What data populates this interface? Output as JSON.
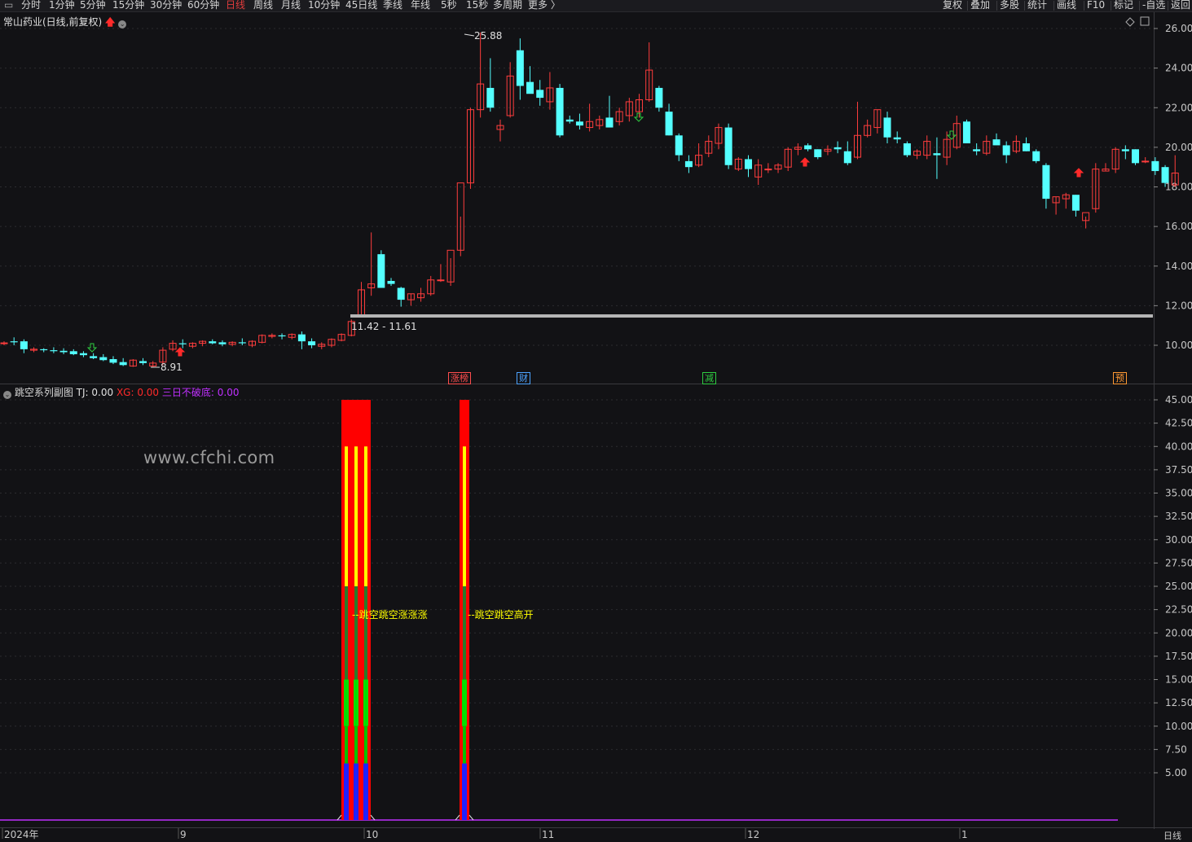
{
  "toolbar": {
    "items": [
      "分时",
      "1分钟",
      "5分钟",
      "15分钟",
      "30分钟",
      "60分钟",
      "日线",
      "周线",
      "月线",
      "10分钟",
      "45日线",
      "季线",
      "年线",
      "5秒",
      "15秒",
      "多周期",
      "更多 〉"
    ],
    "active": "日线",
    "right_items": [
      "复权",
      "叠加",
      "多股",
      "统计",
      "画线",
      "F10",
      "标记",
      "-自选",
      "返回"
    ]
  },
  "main": {
    "title": "常山药业(日线,前复权)",
    "high_label": "25.88",
    "low_label": "8.91",
    "range_label": "11.42 - 11.61",
    "price_ticks": [
      "26.00",
      "24.00",
      "22.00",
      "20.00",
      "18.00",
      "16.00",
      "14.00",
      "12.00",
      "10.00"
    ],
    "tags": [
      {
        "text": "涨榜",
        "color": "#ff4d4d"
      },
      {
        "text": "财",
        "color": "#4da3ff"
      },
      {
        "text": "减",
        "color": "#2ecc40"
      },
      {
        "text": "预",
        "color": "#ff9933"
      }
    ]
  },
  "sub": {
    "title": "跳空系列副图",
    "tj": "TJ: 0.00",
    "xg": "XG: 0.00",
    "sanri": "三日不破底: 0.00",
    "annotation1": "跳空跳空涨涨涨",
    "annotation2": "跳空跳空高开",
    "ticks": [
      "45.00",
      "42.50",
      "40.00",
      "37.50",
      "35.00",
      "32.50",
      "30.00",
      "27.50",
      "25.00",
      "22.50",
      "20.00",
      "17.50",
      "15.00",
      "12.50",
      "10.00",
      "7.50",
      "5.00"
    ]
  },
  "watermark": "www.cfchi.com",
  "xaxis": {
    "labels": [
      "2024年",
      "9",
      "10",
      "11",
      "12",
      "1"
    ],
    "period": "日线"
  },
  "colors": {
    "up": "#ff3333",
    "down": "#54ffff",
    "bg": "#121215",
    "grid": "#2a2a2e"
  }
}
